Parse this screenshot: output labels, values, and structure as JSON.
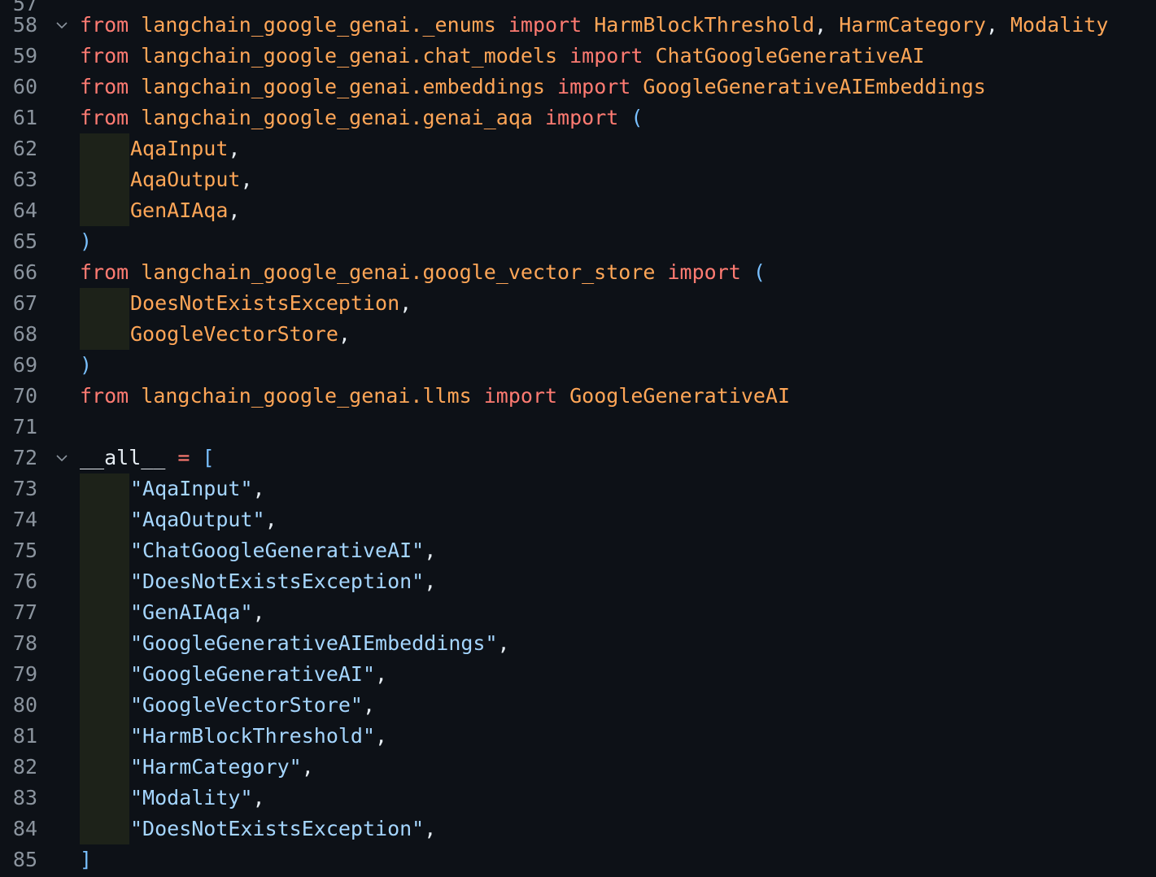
{
  "editor": {
    "partial_top_line_number": "57",
    "lines": [
      {
        "num": "58",
        "fold": true,
        "indent": false,
        "tokens": [
          {
            "t": "from",
            "c": "kw"
          },
          {
            "t": " ",
            "c": "punc"
          },
          {
            "t": "langchain_google_genai._enums",
            "c": "mod"
          },
          {
            "t": " ",
            "c": "punc"
          },
          {
            "t": "import",
            "c": "kw"
          },
          {
            "t": " ",
            "c": "punc"
          },
          {
            "t": "HarmBlockThreshold",
            "c": "cls"
          },
          {
            "t": ", ",
            "c": "punc"
          },
          {
            "t": "HarmCategory",
            "c": "cls"
          },
          {
            "t": ", ",
            "c": "punc"
          },
          {
            "t": "Modality",
            "c": "cls"
          }
        ]
      },
      {
        "num": "59",
        "fold": false,
        "indent": false,
        "tokens": [
          {
            "t": "from",
            "c": "kw"
          },
          {
            "t": " ",
            "c": "punc"
          },
          {
            "t": "langchain_google_genai.chat_models",
            "c": "mod"
          },
          {
            "t": " ",
            "c": "punc"
          },
          {
            "t": "import",
            "c": "kw"
          },
          {
            "t": " ",
            "c": "punc"
          },
          {
            "t": "ChatGoogleGenerativeAI",
            "c": "cls"
          }
        ]
      },
      {
        "num": "60",
        "fold": false,
        "indent": false,
        "tokens": [
          {
            "t": "from",
            "c": "kw"
          },
          {
            "t": " ",
            "c": "punc"
          },
          {
            "t": "langchain_google_genai.embeddings",
            "c": "mod"
          },
          {
            "t": " ",
            "c": "punc"
          },
          {
            "t": "import",
            "c": "kw"
          },
          {
            "t": " ",
            "c": "punc"
          },
          {
            "t": "GoogleGenerativeAIEmbeddings",
            "c": "cls"
          }
        ]
      },
      {
        "num": "61",
        "fold": false,
        "indent": false,
        "tokens": [
          {
            "t": "from",
            "c": "kw"
          },
          {
            "t": " ",
            "c": "punc"
          },
          {
            "t": "langchain_google_genai.genai_aqa",
            "c": "mod"
          },
          {
            "t": " ",
            "c": "punc"
          },
          {
            "t": "import",
            "c": "kw"
          },
          {
            "t": " ",
            "c": "punc"
          },
          {
            "t": "(",
            "c": "paren"
          }
        ]
      },
      {
        "num": "62",
        "fold": false,
        "indent": true,
        "tokens": [
          {
            "t": "AqaInput",
            "c": "cls"
          },
          {
            "t": ",",
            "c": "punc"
          }
        ]
      },
      {
        "num": "63",
        "fold": false,
        "indent": true,
        "tokens": [
          {
            "t": "AqaOutput",
            "c": "cls"
          },
          {
            "t": ",",
            "c": "punc"
          }
        ]
      },
      {
        "num": "64",
        "fold": false,
        "indent": true,
        "tokens": [
          {
            "t": "GenAIAqa",
            "c": "cls"
          },
          {
            "t": ",",
            "c": "punc"
          }
        ]
      },
      {
        "num": "65",
        "fold": false,
        "indent": false,
        "tokens": [
          {
            "t": ")",
            "c": "paren"
          }
        ]
      },
      {
        "num": "66",
        "fold": false,
        "indent": false,
        "tokens": [
          {
            "t": "from",
            "c": "kw"
          },
          {
            "t": " ",
            "c": "punc"
          },
          {
            "t": "langchain_google_genai.google_vector_store",
            "c": "mod"
          },
          {
            "t": " ",
            "c": "punc"
          },
          {
            "t": "import",
            "c": "kw"
          },
          {
            "t": " ",
            "c": "punc"
          },
          {
            "t": "(",
            "c": "paren"
          }
        ]
      },
      {
        "num": "67",
        "fold": false,
        "indent": true,
        "tokens": [
          {
            "t": "DoesNotExistsException",
            "c": "cls"
          },
          {
            "t": ",",
            "c": "punc"
          }
        ]
      },
      {
        "num": "68",
        "fold": false,
        "indent": true,
        "tokens": [
          {
            "t": "GoogleVectorStore",
            "c": "cls"
          },
          {
            "t": ",",
            "c": "punc"
          }
        ]
      },
      {
        "num": "69",
        "fold": false,
        "indent": false,
        "tokens": [
          {
            "t": ")",
            "c": "paren"
          }
        ]
      },
      {
        "num": "70",
        "fold": false,
        "indent": false,
        "tokens": [
          {
            "t": "from",
            "c": "kw"
          },
          {
            "t": " ",
            "c": "punc"
          },
          {
            "t": "langchain_google_genai.llms",
            "c": "mod"
          },
          {
            "t": " ",
            "c": "punc"
          },
          {
            "t": "import",
            "c": "kw"
          },
          {
            "t": " ",
            "c": "punc"
          },
          {
            "t": "GoogleGenerativeAI",
            "c": "cls"
          }
        ]
      },
      {
        "num": "71",
        "fold": false,
        "indent": false,
        "tokens": []
      },
      {
        "num": "72",
        "fold": true,
        "indent": false,
        "tokens": [
          {
            "t": "__all__",
            "c": "var"
          },
          {
            "t": " ",
            "c": "punc"
          },
          {
            "t": "=",
            "c": "op"
          },
          {
            "t": " ",
            "c": "punc"
          },
          {
            "t": "[",
            "c": "paren"
          }
        ]
      },
      {
        "num": "73",
        "fold": false,
        "indent": true,
        "tokens": [
          {
            "t": "\"AqaInput\"",
            "c": "str"
          },
          {
            "t": ",",
            "c": "punc"
          }
        ]
      },
      {
        "num": "74",
        "fold": false,
        "indent": true,
        "tokens": [
          {
            "t": "\"AqaOutput\"",
            "c": "str"
          },
          {
            "t": ",",
            "c": "punc"
          }
        ]
      },
      {
        "num": "75",
        "fold": false,
        "indent": true,
        "tokens": [
          {
            "t": "\"ChatGoogleGenerativeAI\"",
            "c": "str"
          },
          {
            "t": ",",
            "c": "punc"
          }
        ]
      },
      {
        "num": "76",
        "fold": false,
        "indent": true,
        "tokens": [
          {
            "t": "\"DoesNotExistsException\"",
            "c": "str"
          },
          {
            "t": ",",
            "c": "punc"
          }
        ]
      },
      {
        "num": "77",
        "fold": false,
        "indent": true,
        "tokens": [
          {
            "t": "\"GenAIAqa\"",
            "c": "str"
          },
          {
            "t": ",",
            "c": "punc"
          }
        ]
      },
      {
        "num": "78",
        "fold": false,
        "indent": true,
        "tokens": [
          {
            "t": "\"GoogleGenerativeAIEmbeddings\"",
            "c": "str"
          },
          {
            "t": ",",
            "c": "punc"
          }
        ]
      },
      {
        "num": "79",
        "fold": false,
        "indent": true,
        "tokens": [
          {
            "t": "\"GoogleGenerativeAI\"",
            "c": "str"
          },
          {
            "t": ",",
            "c": "punc"
          }
        ]
      },
      {
        "num": "80",
        "fold": false,
        "indent": true,
        "tokens": [
          {
            "t": "\"GoogleVectorStore\"",
            "c": "str"
          },
          {
            "t": ",",
            "c": "punc"
          }
        ]
      },
      {
        "num": "81",
        "fold": false,
        "indent": true,
        "tokens": [
          {
            "t": "\"HarmBlockThreshold\"",
            "c": "str"
          },
          {
            "t": ",",
            "c": "punc"
          }
        ]
      },
      {
        "num": "82",
        "fold": false,
        "indent": true,
        "tokens": [
          {
            "t": "\"HarmCategory\"",
            "c": "str"
          },
          {
            "t": ",",
            "c": "punc"
          }
        ]
      },
      {
        "num": "83",
        "fold": false,
        "indent": true,
        "tokens": [
          {
            "t": "\"Modality\"",
            "c": "str"
          },
          {
            "t": ",",
            "c": "punc"
          }
        ]
      },
      {
        "num": "84",
        "fold": false,
        "indent": true,
        "tokens": [
          {
            "t": "\"DoesNotExistsException\"",
            "c": "str"
          },
          {
            "t": ",",
            "c": "punc"
          }
        ]
      },
      {
        "num": "85",
        "fold": false,
        "indent": false,
        "tokens": [
          {
            "t": "]",
            "c": "paren"
          }
        ]
      }
    ]
  },
  "colors": {
    "background": "#0d1117",
    "line_number": "#8b949e",
    "keyword": "#ff7b72",
    "module": "#ffa657",
    "class": "#ffa657",
    "string": "#a5d6ff",
    "bracket": "#79c0ff",
    "text": "#e6edf3",
    "indent_guide": "#1d2219"
  },
  "icons": {
    "fold": "chevron-down-icon"
  }
}
